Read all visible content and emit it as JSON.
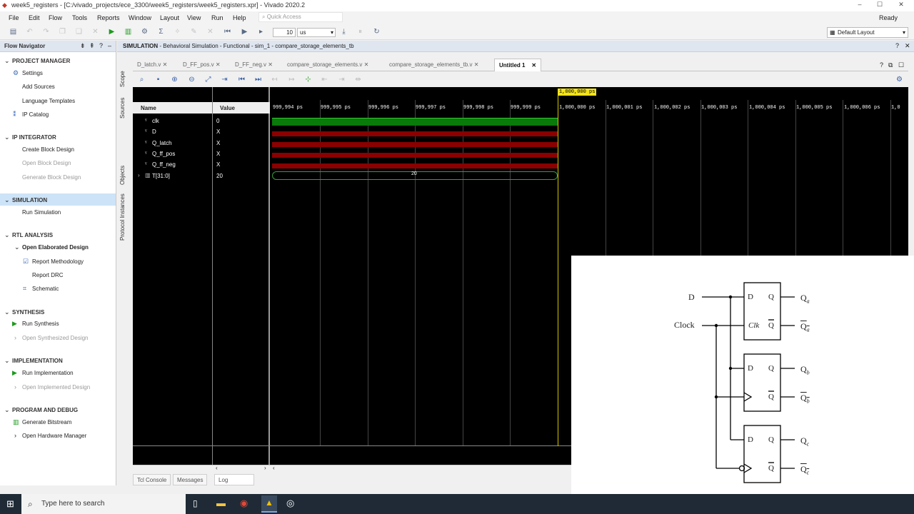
{
  "window": {
    "title": "week5_registers - [C:/vivado_projects/ece_3300/week5_registers/week5_registers.xpr] - Vivado 2020.2",
    "min": "–",
    "max": "☐",
    "close": "✕"
  },
  "menu": {
    "items": [
      "File",
      "Edit",
      "Flow",
      "Tools",
      "Reports",
      "Window",
      "Layout",
      "View",
      "Run",
      "Help"
    ],
    "quick_access": "Quick Access",
    "status": "Ready"
  },
  "toolbar": {
    "sim_time": "10",
    "sim_unit": "us",
    "layout": "Default Layout"
  },
  "flow_navigator": {
    "title": "Flow Navigator",
    "sections": {
      "project_manager": "PROJECT MANAGER",
      "settings": "Settings",
      "add_sources": "Add Sources",
      "language_templates": "Language Templates",
      "ip_catalog": "IP Catalog",
      "ip_integrator": "IP INTEGRATOR",
      "create_block": "Create Block Design",
      "open_block": "Open Block Design",
      "generate_block": "Generate Block Design",
      "simulation": "SIMULATION",
      "run_simulation": "Run Simulation",
      "rtl_analysis": "RTL ANALYSIS",
      "open_elaborated": "Open Elaborated Design",
      "report_methodology": "Report Methodology",
      "report_drc": "Report DRC",
      "schematic": "Schematic",
      "synthesis": "SYNTHESIS",
      "run_synthesis": "Run Synthesis",
      "open_synth": "Open Synthesized Design",
      "implementation": "IMPLEMENTATION",
      "run_impl": "Run Implementation",
      "open_impl": "Open Implemented Design",
      "program_debug": "PROGRAM AND DEBUG",
      "gen_bitstream": "Generate Bitstream",
      "open_hw": "Open Hardware Manager"
    }
  },
  "simulation": {
    "header_bold": "SIMULATION",
    "header_rest": " - Behavioral Simulation - Functional - sim_1 - compare_storage_elements_tb",
    "side_tabs": [
      "Scope",
      "Sources",
      "Objects",
      "Protocol Instances"
    ],
    "tabs": [
      "D_latch.v",
      "D_FF_pos.v",
      "D_FF_neg.v",
      "compare_storage_elements.v",
      "compare_storage_elements_tb.v",
      "Untitled 1"
    ],
    "col_name": "Name",
    "col_value": "Value",
    "signals": [
      {
        "name": "clk",
        "value": "0"
      },
      {
        "name": "D",
        "value": "X"
      },
      {
        "name": "Q_latch",
        "value": "X"
      },
      {
        "name": "Q_ff_pos",
        "value": "X"
      },
      {
        "name": "Q_ff_neg",
        "value": "X"
      },
      {
        "name": "T[31:0]",
        "value": "20"
      }
    ],
    "ticks": [
      "999,994 ps",
      "999,995 ps",
      "999,996 ps",
      "999,997 ps",
      "999,998 ps",
      "999,999 ps",
      "1,000,000 ps",
      "1,000,001 ps",
      "1,000,002 ps",
      "1,000,003 ps",
      "1,000,004 ps",
      "1,000,005 ps",
      "1,000,006 ps",
      "1,0"
    ],
    "cursor_label": "1,000,000 ps",
    "bus_value": "20",
    "bottom_tabs": [
      "Tcl Console",
      "Messages",
      "Log"
    ]
  },
  "taskbar": {
    "search": "Type here to search"
  },
  "circuit": {
    "d": "D",
    "clock": "Clock",
    "ff_d": "D",
    "ff_q": "Q",
    "ff_qbar": "Q",
    "clk": "Clk",
    "qa": "Q",
    "qa_sub": "a",
    "qb": "Q",
    "qb_sub": "b",
    "qc": "Q",
    "qc_sub": "c"
  },
  "colors": {
    "clk_wave": "#0a7a0a",
    "x_wave": "#8b0000",
    "cursor": "#f3e31a",
    "selection": "#cde3f7"
  }
}
